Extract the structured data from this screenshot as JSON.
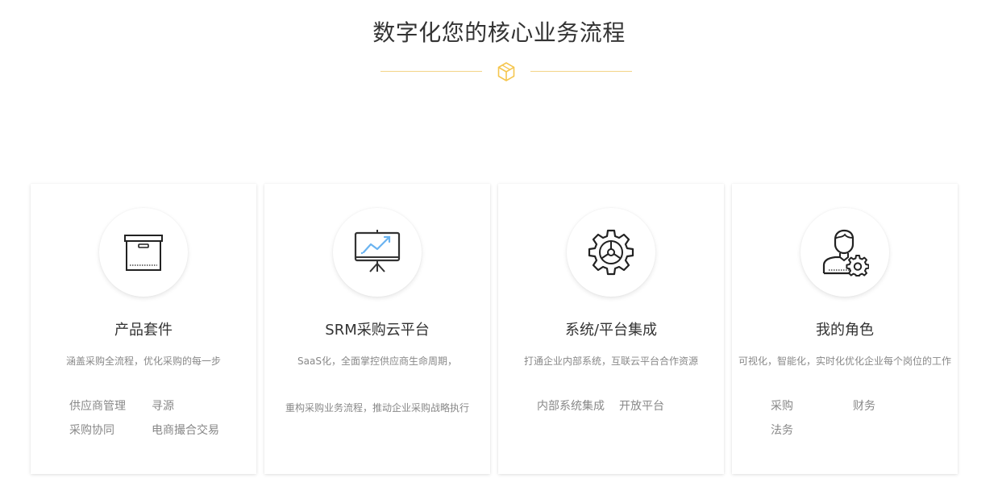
{
  "section": {
    "title": "数字化您的核心业务流程"
  },
  "colors": {
    "accent": "#f5c64f",
    "divider": "#f3d487",
    "icon_blue": "#6ab3f0",
    "text_dark": "#333333",
    "text_muted": "#888888"
  },
  "cards": [
    {
      "icon": "archive-box-icon",
      "title": "产品套件",
      "desc": "涵盖采购全流程，优化采购的每一步",
      "links": [
        "供应商管理",
        "寻源",
        "采购协同",
        "电商撮合交易"
      ]
    },
    {
      "icon": "presentation-chart-icon",
      "title": "SRM采购云平台",
      "desc": "SaaS化，全面掌控供应商生命周期，",
      "desc2": "重构采购业务流程，推动企业采购战略执行"
    },
    {
      "icon": "gear-icon",
      "title": "系统/平台集成",
      "desc": "打通企业内部系统，互联云平台合作资源",
      "links": [
        "内部系统集成",
        "开放平台"
      ]
    },
    {
      "icon": "user-gear-icon",
      "title": "我的角色",
      "desc": "可视化，智能化，实时化优化企业每个岗位的工作",
      "links": [
        "采购",
        "财务",
        "法务"
      ]
    }
  ]
}
